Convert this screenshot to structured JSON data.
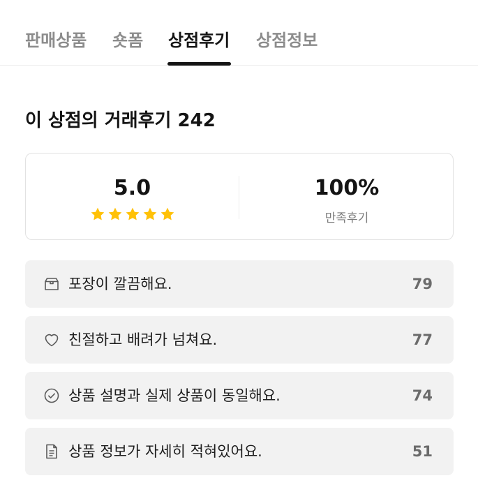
{
  "tabs": [
    {
      "label": "판매상품"
    },
    {
      "label": "숏폼"
    },
    {
      "label": "상점후기"
    },
    {
      "label": "상점정보"
    }
  ],
  "active_tab": "상점후기",
  "review_title": "이 상점의 거래후기 242",
  "summary": {
    "rating": "5.0",
    "stars": 5,
    "star_color": "#FFC107",
    "satisfaction": "100%",
    "satisfaction_label": "만족후기"
  },
  "reasons": [
    {
      "icon": "package-icon",
      "label": "포장이 깔끔해요.",
      "count": "79"
    },
    {
      "icon": "heart-icon",
      "label": "친절하고 배려가 넘쳐요.",
      "count": "77"
    },
    {
      "icon": "check-circle-icon",
      "label": "상품 설명과 실제 상품이 동일해요.",
      "count": "74"
    },
    {
      "icon": "document-icon",
      "label": "상품 정보가 자세히 적혀있어요.",
      "count": "51"
    }
  ]
}
